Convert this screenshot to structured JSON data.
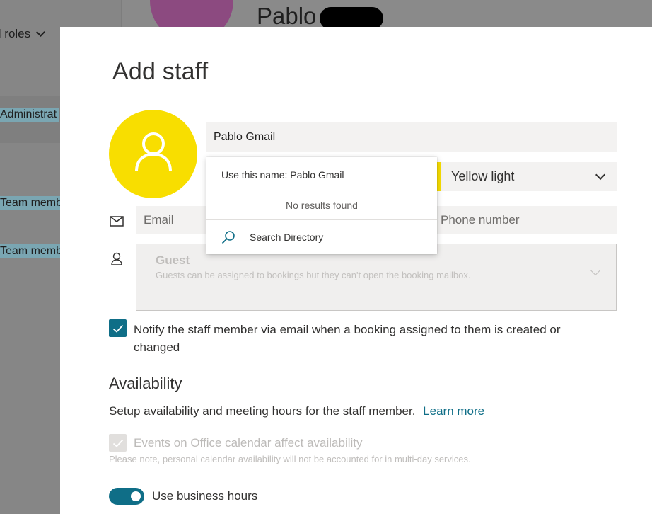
{
  "background": {
    "roles_filter": "ll roles",
    "tags": [
      "Administrat",
      "Team memb",
      "Team memb"
    ],
    "profile_name": "Pablo"
  },
  "panel": {
    "title": "Add staff",
    "name_value": "Pablo Gmail",
    "color": {
      "label": "Yellow light",
      "swatch": "#f8de00"
    },
    "email_placeholder": "Email",
    "phone_placeholder": "Phone number",
    "role": {
      "name": "Guest",
      "description": "Guests can be assigned to bookings but they can't open the booking mailbox."
    },
    "notify": {
      "checked": true,
      "label": "Notify the staff member via email when a booking assigned to them is created or changed"
    },
    "availability": {
      "title": "Availability",
      "description": "Setup availability and meeting hours for the staff member.",
      "learn_more": "Learn more",
      "events_label": "Events on Office calendar affect availability",
      "events_note": "Please note, personal calendar availability will not be accounted for in multi-day services.",
      "business_hours_label": "Use business hours",
      "business_hours_on": true
    }
  },
  "suggestions": {
    "use_name": "Use this name: Pablo Gmail",
    "no_results": "No results found",
    "search_directory": "Search Directory"
  },
  "colors": {
    "accent": "#0f6e87",
    "avatar": "#f8de00"
  }
}
